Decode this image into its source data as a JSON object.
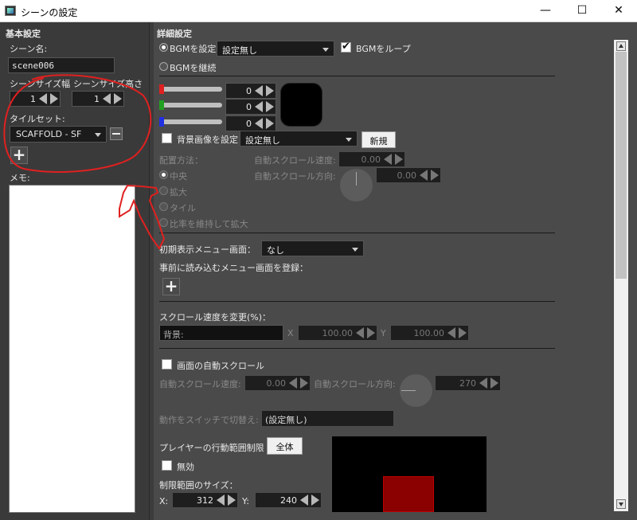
{
  "window": {
    "title": "シーンの設定",
    "controls": [
      "minimize-icon",
      "maximize-icon",
      "close-icon"
    ],
    "control_glyphs": [
      "—",
      "☐",
      "✕"
    ]
  },
  "left": {
    "header": "基本設定",
    "scene_name_label": "シーン名:",
    "scene_name_value": "scene006",
    "size_width_label": "シーンサイズ幅",
    "size_height_label": "シーンサイズ高さ",
    "width_value": "1",
    "height_value": "1",
    "tileset_label": "タイルセット:",
    "tileset_value": "SCAFFOLD - SF",
    "add_glyph": "+",
    "memo_label": "メモ:"
  },
  "right": {
    "header": "詳細設定",
    "bgm_set_label": "BGMを設定",
    "bgm_combo": "設定無し",
    "bgm_loop_label": "BGMをループ",
    "bgm_continue_label": "BGMを継続",
    "color_r": "0",
    "color_g": "0",
    "color_b": "0",
    "bg_image_label": "背景画像を設定",
    "bg_image_combo": "設定無し",
    "new_button": "新規",
    "placement_label": "配置方法：",
    "auto_scroll_speed_label": "自動スクロール速度:",
    "auto_scroll_speed_value": "0.00",
    "auto_scroll_dir_label": "自動スクロール方向:",
    "auto_scroll_dir_value": "0.00",
    "placement_options": [
      "中央",
      "拡大",
      "タイル",
      "比率を維持して拡大"
    ],
    "initial_menu_label": "初期表示メニュー画面：",
    "initial_menu_value": "なし",
    "preload_menu_label": "事前に読み込むメニュー画面を登録：",
    "add_glyph": "+",
    "scroll_speed_label": "スクロール速度を変更(%)：",
    "bg_field_placeholder": "背景:",
    "x_label": "X",
    "x_value": "100.00",
    "y_label": "Y",
    "y_value": "100.00",
    "screen_auto_scroll_label": "画面の自動スクロール",
    "screen_scroll_speed_label": "自動スクロール速度:",
    "screen_scroll_speed_value": "0.00",
    "screen_scroll_dir_label": "自動スクロール方向:",
    "screen_scroll_dir_value": "270",
    "switch_label": "動作をスイッチで切替え:",
    "switch_value": "(設定無し)",
    "player_range_label": "プレイヤーの行動範囲制限",
    "all_button": "全体",
    "disabled_label": "無効",
    "range_size_label": "制限範囲のサイズ：",
    "range_x_label": "X:",
    "range_x_value": "312",
    "range_y_label": "Y:",
    "range_y_value": "240"
  },
  "colors": {
    "swatch": "#000000",
    "slider_r": "#e02020",
    "slider_g": "#20a020",
    "slider_b": "#2030e0",
    "preview_area": "#000000",
    "preview_rect": "#8b0000",
    "annotation": "#e02020"
  }
}
